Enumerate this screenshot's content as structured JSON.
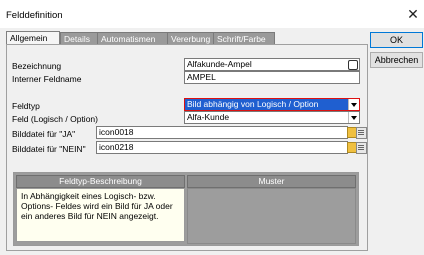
{
  "window": {
    "title": "Felddefinition"
  },
  "tabs": [
    {
      "label": "Allgemein"
    },
    {
      "label": "Details"
    },
    {
      "label": "Automatismen"
    },
    {
      "label": "Vererbung"
    },
    {
      "label": "Schrift/Farbe"
    }
  ],
  "form": {
    "bezeichnung_label": "Bezeichnung",
    "bezeichnung_value": "Alfakunde-Ampel",
    "intern_label": "Interner Feldname",
    "intern_value": "AMPEL",
    "feldtyp_label": "Feldtyp",
    "feldtyp_value": "Bild abhängig von Logisch / Option",
    "feld_label": "Feld (Logisch / Option)",
    "feld_value": "Alfa-Kunde",
    "bild_ja_label": "Bilddatei für \"JA\"",
    "bild_ja_value": "icon0018",
    "bild_nein_label": "Bilddatei für \"NEIN\"",
    "bild_nein_value": "icon0218"
  },
  "description": {
    "header": "Feldtyp-Beschreibung",
    "text": "In Abhängigkeit eines Logisch- bzw. Options- Feldes wird ein Bild für JA oder ein anderes Bild für NEIN angezeigt.",
    "muster_header": "Muster"
  },
  "buttons": {
    "ok": "OK",
    "cancel": "Abbrechen"
  },
  "colors": {
    "selection": "#1f5fd0",
    "tab_inactive": "#9a9a9a",
    "desc_bg": "#fffff0"
  }
}
